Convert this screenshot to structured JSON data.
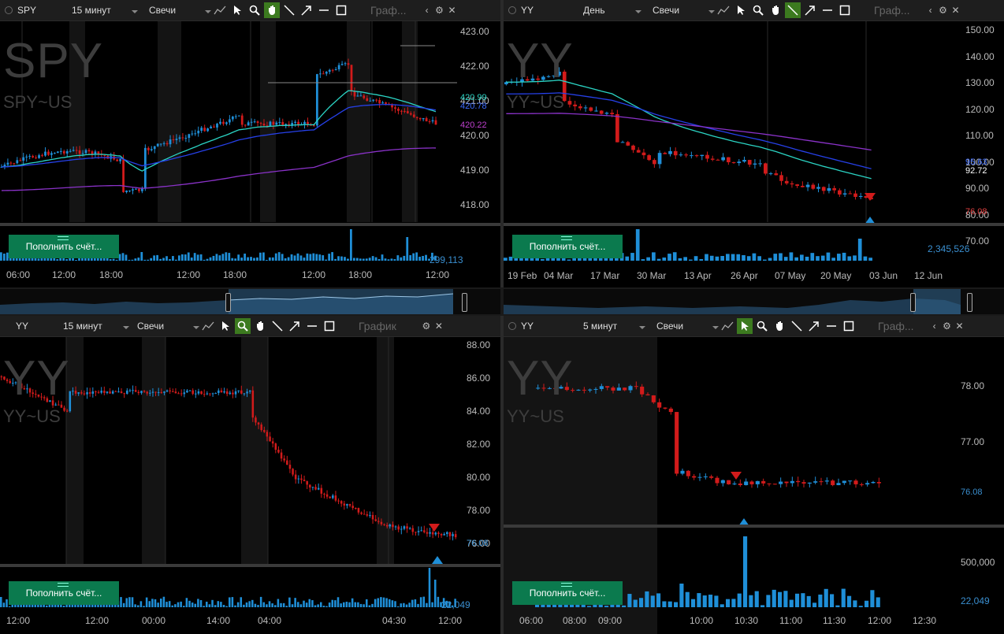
{
  "panels": {
    "spy": {
      "symbol": "SPY",
      "interval": "15 минут",
      "chart_type": "Свечи",
      "title_label": "Граф...",
      "big_symbol": "SPY",
      "sub_symbol": "SPY~US",
      "y_ticks": [
        "423.00",
        "422.00",
        "421.00",
        "420.00",
        "419.00",
        "418.00"
      ],
      "price_tags": [
        "420.99",
        "420.78",
        "420.22"
      ],
      "volume_value": "299,113",
      "x_ticks": [
        "06:00",
        "12:00",
        "18:00",
        "12:00",
        "18:00",
        "12:00",
        "18:00",
        "12:00"
      ],
      "fund_button": "Пополнить счёт..."
    },
    "yy_day": {
      "symbol": "YY",
      "interval": "День",
      "chart_type": "Свечи",
      "title_label": "Граф...",
      "big_symbol": "YY",
      "sub_symbol": "YY~US",
      "y_ticks": [
        "150.00",
        "140.00",
        "130.00",
        "120.00",
        "110.00",
        "100.00",
        "90.00",
        "80.00",
        "70.00"
      ],
      "price_tags": [
        "95.63",
        "92.72",
        "76.08"
      ],
      "volume_value": "2,345,526",
      "x_ticks": [
        "19 Feb",
        "04 Mar",
        "17 Mar",
        "30 Mar",
        "13 Apr",
        "26 Apr",
        "07 May",
        "20 May",
        "03 Jun",
        "12 Jun"
      ],
      "fund_button": "Пополнить счёт..."
    },
    "yy_15": {
      "symbol": "YY",
      "interval": "15 минут",
      "chart_type": "Свечи",
      "title_label": "График",
      "big_symbol": "YY",
      "sub_symbol": "YY~US",
      "y_ticks": [
        "88.00",
        "86.00",
        "84.00",
        "82.00",
        "80.00",
        "78.00",
        "76.00"
      ],
      "price_tags": [
        "76.08"
      ],
      "volume_value": "22,049",
      "x_ticks": [
        "12:00",
        "12:00",
        "00:00",
        "14:00",
        "04:00",
        "04:30",
        "12:00"
      ],
      "fund_button": "Пополнить счёт..."
    },
    "yy_5": {
      "symbol": "YY",
      "interval": "5 минут",
      "chart_type": "Свечи",
      "title_label": "Граф...",
      "big_symbol": "YY",
      "sub_symbol": "YY~US",
      "y_ticks": [
        "78.00",
        "77.00",
        "76.00"
      ],
      "price_tags": [
        "76.08"
      ],
      "vol_ticks": [
        "500,000"
      ],
      "volume_value": "22,049",
      "x_ticks": [
        "06:00",
        "08:00",
        "09:00",
        "10:00",
        "10:30",
        "11:00",
        "11:30",
        "12:00",
        "12:30"
      ],
      "fund_button": "Пополнить счёт..."
    }
  },
  "icons": [
    "radio-icon",
    "draw-tool-icon",
    "cursor-icon",
    "zoom-icon",
    "hand-icon",
    "line-icon",
    "arrow-icon",
    "hline-icon",
    "rect-icon",
    "chevron-left-icon",
    "gear-icon",
    "close-icon"
  ],
  "colors": {
    "up": "#1f8fd8",
    "down": "#d21b1b",
    "ema_fast": "#2bd4c4",
    "ema_mid": "#2640e8",
    "ema_slow": "#8a32c8",
    "fund": "#0b7a4e"
  }
}
